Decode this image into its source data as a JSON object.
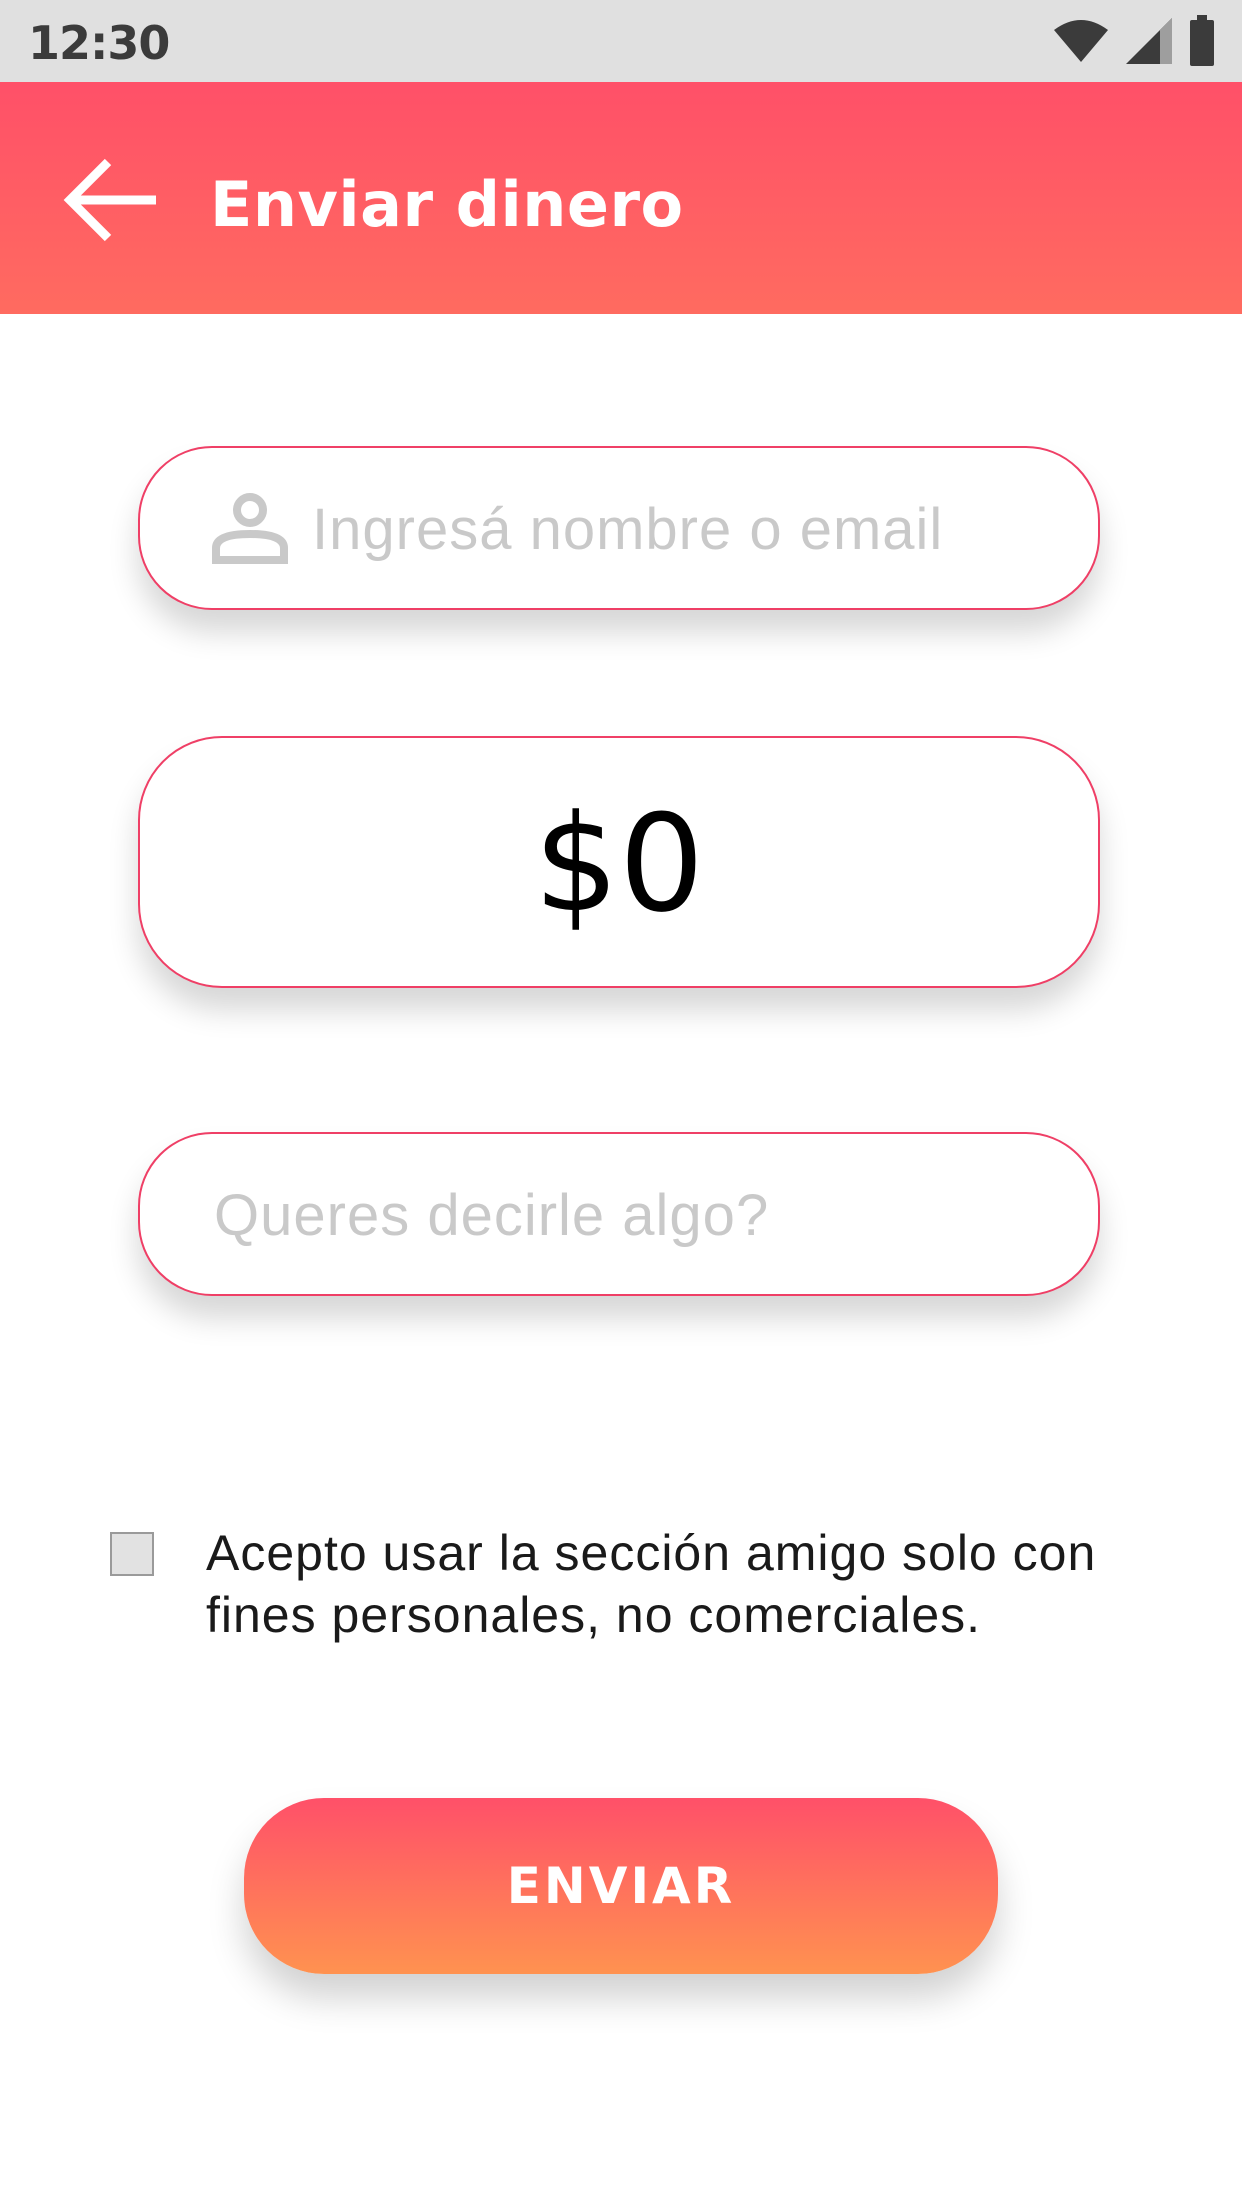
{
  "status_bar": {
    "time": "12:30",
    "icons": [
      "wifi-icon",
      "cell-signal-icon",
      "battery-icon"
    ]
  },
  "app_bar": {
    "title": "Enviar dinero",
    "back_icon": "arrow-left-icon",
    "colors": [
      "#ff5068",
      "#ff6b60"
    ]
  },
  "form": {
    "recipient": {
      "placeholder": "Ingresá nombre o email",
      "value": "",
      "icon": "person-icon"
    },
    "amount": {
      "value": "$0"
    },
    "message": {
      "placeholder": "Queres decirle algo?",
      "value": ""
    },
    "terms": {
      "checked": false,
      "text": "Acepto usar la sección amigo solo con fines personales, no comerciales."
    },
    "submit_label": "ENVIAR"
  },
  "colors": {
    "accent": "#ef3f66",
    "button_top": "#ff5069",
    "button_bottom": "#ff9250"
  }
}
